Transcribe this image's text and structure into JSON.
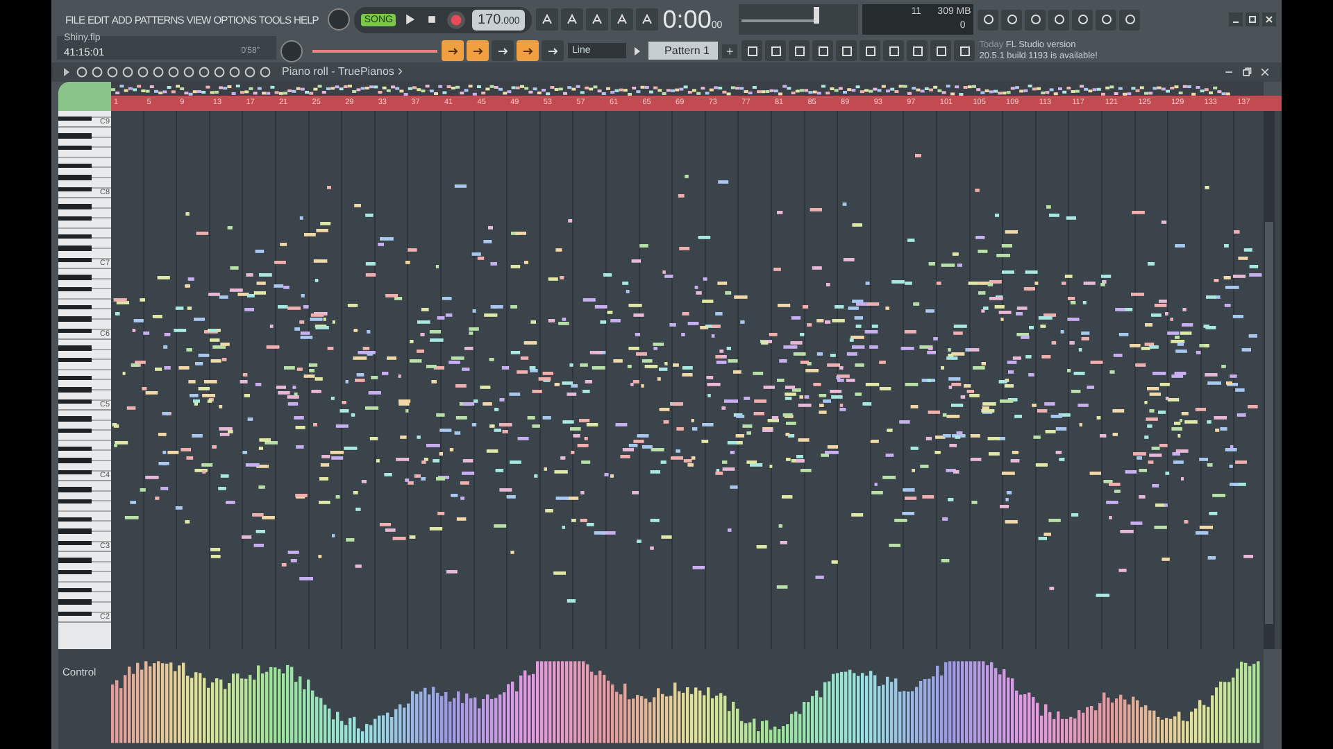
{
  "menu": [
    "FILE",
    "EDIT",
    "ADD",
    "PATTERNS",
    "VIEW",
    "OPTIONS",
    "TOOLS",
    "HELP"
  ],
  "project": {
    "file": "Shiny.flp",
    "position": "41:15:01",
    "length": "0'58\""
  },
  "transport": {
    "mode": "SONG",
    "tempo": "170",
    "tempo_fraction": ".000"
  },
  "time": {
    "main": "0:00",
    "small": "00"
  },
  "monitor": {
    "cpu": "11",
    "memory": "309 MB",
    "polyphony": "0"
  },
  "mode_buttons": [
    {
      "on": true
    },
    {
      "on": true
    },
    {
      "on": false
    },
    {
      "on": true
    },
    {
      "on": false
    }
  ],
  "pitch_slider": {
    "level": 1
  },
  "snap": "Line",
  "pattern": {
    "name": "Pattern 1",
    "add": "+"
  },
  "news": {
    "label": "Today",
    "title": "FL Studio version",
    "body": "20.5.1 build 1193 is available!"
  },
  "piano_roll": {
    "title": "Piano roll - TruePianos",
    "ruler": [
      "1",
      "5",
      "9",
      "13",
      "17",
      "21",
      "25",
      "29",
      "33",
      "37",
      "41",
      "45",
      "49",
      "53",
      "57",
      "61",
      "65",
      "69",
      "73",
      "77",
      "81",
      "85",
      "89",
      "93",
      "97",
      "101",
      "105",
      "109",
      "113",
      "117",
      "121",
      "125",
      "129",
      "133",
      "137"
    ],
    "octaves": [
      "C9",
      "C8",
      "C7",
      "C6",
      "C5",
      "C4",
      "C3",
      "C2"
    ],
    "control_label": "Control"
  }
}
